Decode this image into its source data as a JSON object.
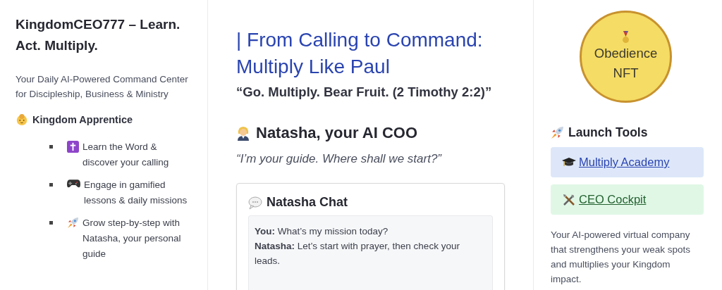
{
  "sidebar": {
    "title": "KingdomCEO777 – Learn. Act. Multiply.",
    "tagline": "Your Daily AI-Powered Command Center for Discipleship, Business & Ministry",
    "level": "Kingdom Apprentice",
    "features": [
      {
        "kind": "cross",
        "text": "Learn the Word & discover your calling"
      },
      {
        "kind": "gamepad",
        "text": "Engage in gamified lessons & daily missions"
      },
      {
        "kind": "rocket",
        "text": "Grow step-by-step with Natasha, your personal guide"
      }
    ]
  },
  "main": {
    "heading": "| From Calling to Command: Multiply Like Paul",
    "verse": "“Go. Multiply. Bear Fruit. (2 Timothy 2:2)”",
    "assistant_heading": "Natasha, your AI COO",
    "assistant_quote": "“I’m your guide. Where shall we start?”",
    "chat": {
      "title": "Natasha Chat",
      "messages": [
        "**You:** What’s my mission today?",
        "**Natasha:** Let’s start with prayer, then check your leads."
      ]
    }
  },
  "right": {
    "badge": "Obedience NFT",
    "tools_heading": "Launch Tools",
    "tools": [
      {
        "kind": "academy",
        "label": "Multiply Academy"
      },
      {
        "kind": "cockpit",
        "label": "CEO Cockpit"
      }
    ],
    "description": "Your AI-powered virtual company that strengthens your weak spots and multiplies your Kingdom impact."
  }
}
